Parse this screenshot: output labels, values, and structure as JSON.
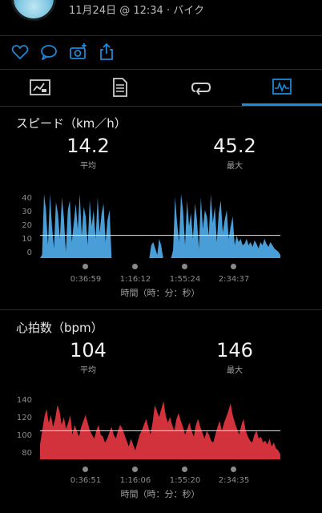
{
  "header": {
    "activity_info": "11月24日 @ 12:34 · バイク"
  },
  "actions": {
    "like_icon": "heart-icon",
    "comment_icon": "comment-icon",
    "photo_icon": "camera-add-icon",
    "share_icon": "share-icon"
  },
  "tabs": [
    {
      "name": "summary",
      "icon": "chart-card-icon"
    },
    {
      "name": "details",
      "icon": "document-icon"
    },
    {
      "name": "laps",
      "icon": "laps-icon"
    },
    {
      "name": "graphs",
      "icon": "graph-icon",
      "active": true
    }
  ],
  "colors": {
    "accent": "#1e88d6",
    "speed": "#4a9ed8",
    "heart": "#d2323c"
  },
  "speed": {
    "title": "スピード（km／h）",
    "avg_value": "14.2",
    "avg_label": "平均",
    "max_value": "45.2",
    "max_label": "最大",
    "yticks": [
      "40",
      "30",
      "20",
      "10",
      "0"
    ],
    "xticks": [
      "0:36:59",
      "1:16:12",
      "1:55:24",
      "2:34:37"
    ],
    "xtitle": "時間（時：分：秒）"
  },
  "heart": {
    "title": "心拍数（bpm）",
    "avg_value": "104",
    "avg_label": "平均",
    "max_value": "146",
    "max_label": "最大",
    "yticks": [
      "140",
      "120",
      "100",
      "80"
    ],
    "xticks": [
      "0:36:51",
      "1:16:06",
      "1:55:20",
      "2:34:35"
    ],
    "xtitle": "時間（時：分：秒）"
  },
  "chart_data": [
    {
      "type": "area",
      "title": "スピード（km／h）",
      "xlabel": "時間（時：分：秒）",
      "ylim": [
        0,
        40
      ],
      "x_tick_labels": [
        "0:36:59",
        "1:16:12",
        "1:55:24",
        "2:34:37"
      ],
      "average": 14.2,
      "max": 45.2,
      "series": [
        {
          "values": [
            0,
            2,
            42,
            30,
            8,
            40,
            20,
            6,
            35,
            28,
            12,
            38,
            25,
            4,
            30,
            36,
            10,
            22,
            34,
            18,
            40,
            14,
            32,
            26,
            8,
            36,
            20,
            30,
            12,
            38,
            16,
            28,
            34,
            10,
            24,
            30,
            0,
            0,
            0,
            0,
            0,
            0,
            0,
            0,
            0,
            0,
            0,
            0,
            0,
            0,
            0,
            0,
            0,
            0,
            0,
            0,
            8,
            10,
            6,
            2,
            12,
            8,
            0,
            0,
            0,
            0,
            0,
            5,
            38,
            22,
            10,
            40,
            30,
            8,
            36,
            20,
            28,
            12,
            34,
            24,
            6,
            38,
            18,
            30,
            26,
            14,
            40,
            22,
            32,
            10,
            28,
            36,
            16,
            24,
            30,
            12,
            20,
            26,
            8,
            14,
            10,
            12,
            8,
            9,
            12,
            8,
            10,
            7,
            11,
            9,
            6,
            10,
            8,
            12,
            9,
            7,
            10,
            8,
            6,
            5,
            4,
            2
          ]
        }
      ]
    },
    {
      "type": "area",
      "title": "心拍数（bpm）",
      "xlabel": "時間（時：分：秒）",
      "ylim": [
        75,
        145
      ],
      "x_tick_labels": [
        "0:36:51",
        "1:16:06",
        "1:55:20",
        "2:34:35"
      ],
      "average": 104,
      "max": 146,
      "series": [
        {
          "values": [
            90,
            104,
            118,
            126,
            112,
            120,
            108,
            116,
            130,
            124,
            110,
            118,
            106,
            112,
            120,
            100,
            110,
            104,
            98,
            108,
            114,
            120,
            112,
            104,
            100,
            96,
            104,
            110,
            100,
            98,
            92,
            96,
            102,
            108,
            100,
            96,
            104,
            110,
            106,
            100,
            94,
            88,
            96,
            90,
            84,
            92,
            100,
            104,
            110,
            116,
            108,
            100,
            112,
            130,
            124,
            118,
            126,
            134,
            120,
            112,
            118,
            110,
            104,
            116,
            122,
            114,
            108,
            100,
            106,
            112,
            104,
            98,
            110,
            116,
            108,
            102,
            96,
            104,
            100,
            94,
            92,
            100,
            108,
            114,
            104,
            112,
            118,
            124,
            132,
            120,
            112,
            106,
            100,
            110,
            116,
            104,
            98,
            94,
            92,
            100,
            104,
            96,
            98,
            92,
            94,
            90,
            96,
            88,
            92,
            86,
            84,
            80
          ]
        }
      ]
    }
  ]
}
